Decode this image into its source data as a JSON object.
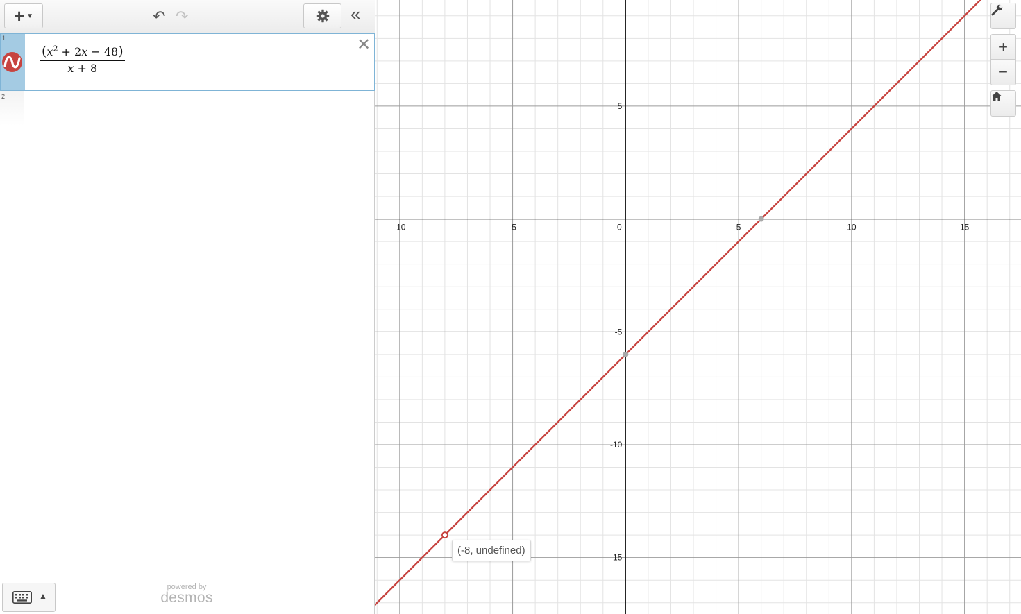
{
  "toolbar": {
    "add_label": "+",
    "settings_icon": "gear-icon",
    "undo_icon": "undo-icon",
    "redo_icon": "redo-icon",
    "collapse_icon": "double-chevron-left-icon"
  },
  "expressions": [
    {
      "index": "1",
      "color": "#c74440",
      "numerator": {
        "open": "(",
        "x": "x",
        "exp": "2",
        "rest": " + 2",
        "x2": "x",
        "tail": " − 48",
        "close": ")"
      },
      "denominator": {
        "x": "x",
        "rest": " + 8"
      }
    },
    {
      "index": "2"
    }
  ],
  "footer": {
    "powered_by": "powered by",
    "brand": "desmos"
  },
  "graph": {
    "tools": {
      "wrench": "wrench-icon",
      "zoom_in": "+",
      "zoom_out": "−",
      "home": "home-icon"
    },
    "tooltip": "(-8, undefined)"
  },
  "chart_data": {
    "type": "line",
    "function": "(x^2+2x-48)/(x+8)",
    "x_ticks": [
      "-10",
      "-5",
      "0",
      "5",
      "10",
      "15"
    ],
    "y_ticks": [
      "5",
      "-5",
      "-10",
      "-15"
    ],
    "xlim": [
      -11.1,
      17.5
    ],
    "ylim": [
      -17.5,
      9.7
    ],
    "grid": true,
    "series": [
      {
        "color": "#c74440",
        "x": [
          -11.1,
          17.5
        ],
        "y": [
          -17.1,
          11.5
        ]
      }
    ],
    "points": [
      {
        "x": 6,
        "y": 0,
        "kind": "root"
      },
      {
        "x": 0,
        "y": -6,
        "kind": "y-intercept"
      },
      {
        "x": -8,
        "y": -14,
        "kind": "hole",
        "label": "(-8, undefined)"
      }
    ]
  }
}
